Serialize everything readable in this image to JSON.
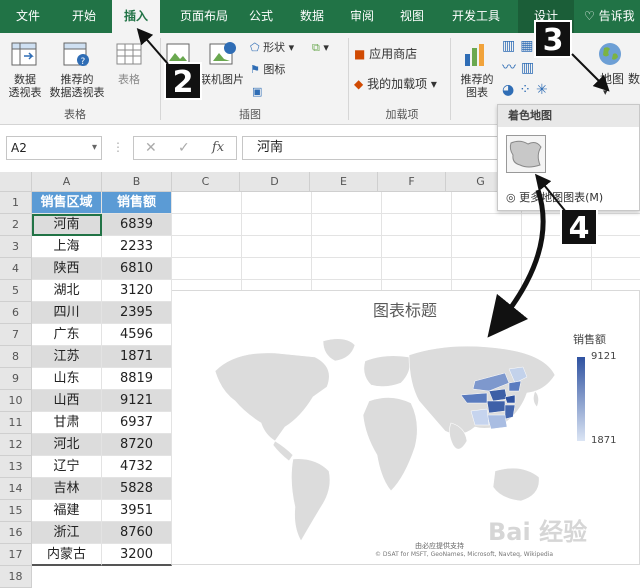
{
  "ribbon": {
    "tabs": [
      "文件",
      "开始",
      "插入",
      "页面布局",
      "公式",
      "数据",
      "审阅",
      "视图",
      "开发工具",
      "设计"
    ],
    "tell_me": "告诉我",
    "buttons": {
      "pivot": [
        "数据",
        "透视表"
      ],
      "rec_pivot": [
        "推荐的",
        "数据透视表"
      ],
      "table": "表格",
      "online_pic": "联机图片",
      "shapes": "形状",
      "icons": "图标",
      "app_store": "应用商店",
      "my_addins": "我的加载项",
      "rec_charts": [
        "推荐的",
        "图表"
      ],
      "map": "地图",
      "more": "数"
    },
    "groups": {
      "tables": "表格",
      "illustrations": "插图",
      "addins": "加载项"
    }
  },
  "map_menu": {
    "title": "着色地图",
    "more": "更多地图图表(M)"
  },
  "formula_bar": {
    "name_box": "A2",
    "fx": "fx",
    "value": "河南"
  },
  "columns": [
    "A",
    "B",
    "C",
    "D",
    "E",
    "F",
    "G"
  ],
  "table": {
    "headers": [
      "销售区域",
      "销售额"
    ],
    "rows": [
      [
        "河南",
        "6839"
      ],
      [
        "上海",
        "2233"
      ],
      [
        "陕西",
        "6810"
      ],
      [
        "湖北",
        "3120"
      ],
      [
        "四川",
        "2395"
      ],
      [
        "广东",
        "4596"
      ],
      [
        "江苏",
        "1871"
      ],
      [
        "山东",
        "8819"
      ],
      [
        "山西",
        "9121"
      ],
      [
        "甘肃",
        "6937"
      ],
      [
        "河北",
        "8720"
      ],
      [
        "辽宁",
        "4732"
      ],
      [
        "吉林",
        "5828"
      ],
      [
        "福建",
        "3951"
      ],
      [
        "浙江",
        "8760"
      ],
      [
        "内蒙古",
        "3200"
      ]
    ]
  },
  "chart": {
    "title": "图表标题",
    "legend_title": "销售额",
    "legend_max": "9121",
    "legend_min": "1871",
    "credit": "由必应提供支持",
    "attribution": "© DSAT for MSFT, GeoNames, Microsoft, Navteq, Wikipedia",
    "low_color": "#dbe5f4",
    "high_color": "#2f52a0"
  },
  "annotations": [
    "1",
    "2",
    "3",
    "4"
  ],
  "watermark": "Bai 经验"
}
